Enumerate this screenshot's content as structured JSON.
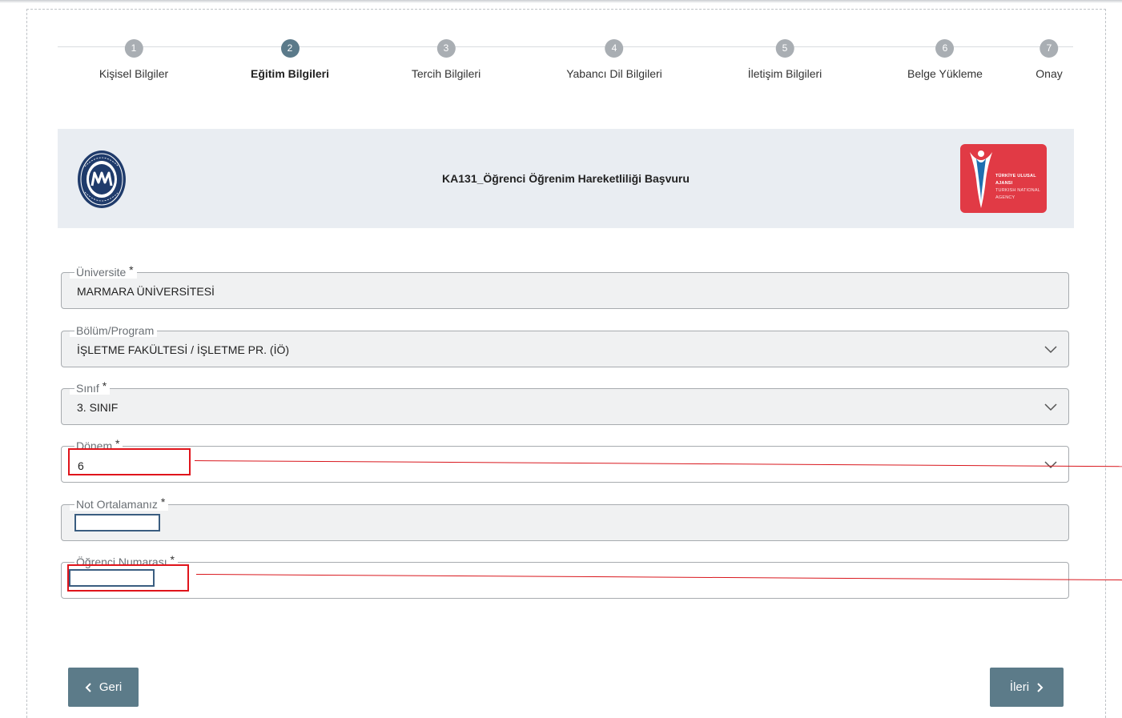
{
  "stepper": {
    "steps": [
      {
        "number": "1",
        "label": "Kişisel Bilgiler",
        "active": false
      },
      {
        "number": "2",
        "label": "Eğitim Bilgileri",
        "active": true
      },
      {
        "number": "3",
        "label": "Tercih Bilgileri",
        "active": false
      },
      {
        "number": "4",
        "label": "Yabancı Dil Bilgileri",
        "active": false
      },
      {
        "number": "5",
        "label": "İletişim Bilgileri",
        "active": false
      },
      {
        "number": "6",
        "label": "Belge Yükleme",
        "active": false
      },
      {
        "number": "7",
        "label": "Onay",
        "active": false
      }
    ]
  },
  "banner": {
    "title": "KA131_Öğrenci Öğrenim Hareketliliği Başvuru",
    "left_logo": "marmara-university-seal",
    "right_logo_text": "TÜRKİYE ULUSAL AJANSI",
    "right_logo_subtext": "TURKISH NATIONAL AGENCY"
  },
  "form": {
    "universite": {
      "label": "Üniversite",
      "required_mark": "*",
      "value": "MARMARA ÜNİVERSİTESİ"
    },
    "bolum": {
      "label": "Bölüm/Program",
      "value": "İŞLETME FAKÜLTESİ / İŞLETME PR. (İÖ)"
    },
    "sinif": {
      "label": "Sınıf",
      "required_mark": "*",
      "value": "3. SINIF"
    },
    "donem": {
      "label": "Dönem",
      "required_mark": "*",
      "value": "6"
    },
    "not_ortalamasi": {
      "label": "Not Ortalamanız",
      "required_mark": "*",
      "value": ""
    },
    "ogrenci_no": {
      "label": "Öğrenci Numarası",
      "required_mark": "*",
      "value": ""
    }
  },
  "buttons": {
    "back_label": "Geri",
    "next_label": "İleri"
  },
  "colors": {
    "accent": "#5c7b89",
    "annotation_red": "#e0141b",
    "banner_bg": "#e9edf2",
    "agency_red": "#e13a45"
  }
}
